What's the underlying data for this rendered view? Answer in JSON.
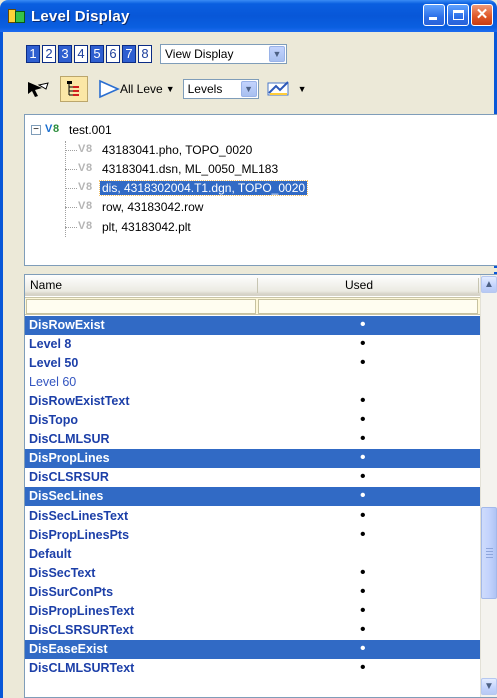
{
  "window": {
    "title": "Level Display"
  },
  "toolbar1": {
    "view_numbers": [
      "1",
      "2",
      "3",
      "4",
      "5",
      "6",
      "7",
      "8"
    ],
    "view_mode": "View Display"
  },
  "toolbar2": {
    "all_levels_label": "All Leve",
    "levels_select": "Levels"
  },
  "tree": {
    "root": "test.001",
    "children": [
      "43183041.pho, TOPO_0020",
      "43183041.dsn, ML_0050_ML183",
      "dis, 4318302004.T1.dgn, TOPO_0020",
      "row, 43183042.row",
      "plt, 43183042.plt"
    ],
    "selected_index": 2
  },
  "list": {
    "columns": [
      "Name",
      "Used"
    ],
    "rows": [
      {
        "name": "DisRowExist",
        "used": "•",
        "selected": true
      },
      {
        "name": "Level 8",
        "used": "•",
        "selected": false
      },
      {
        "name": "Level 50",
        "used": "•",
        "selected": false
      },
      {
        "name": "Level 60",
        "used": "",
        "selected": false
      },
      {
        "name": "DisRowExistText",
        "used": "•",
        "selected": false
      },
      {
        "name": "DisTopo",
        "used": "•",
        "selected": false
      },
      {
        "name": "DisCLMLSUR",
        "used": "•",
        "selected": false
      },
      {
        "name": "DisPropLines",
        "used": "•",
        "selected": true
      },
      {
        "name": "DisCLSRSUR",
        "used": "•",
        "selected": false
      },
      {
        "name": "DisSecLines",
        "used": "•",
        "selected": true
      },
      {
        "name": "DisSecLinesText",
        "used": "•",
        "selected": false
      },
      {
        "name": "DisPropLinesPts",
        "used": "•",
        "selected": false
      },
      {
        "name": "Default",
        "used": "",
        "selected": false
      },
      {
        "name": "DisSecText",
        "used": "•",
        "selected": false
      },
      {
        "name": "DisSurConPts",
        "used": "•",
        "selected": false
      },
      {
        "name": "DisPropLinesText",
        "used": "•",
        "selected": false
      },
      {
        "name": "DisCLSRSURText",
        "used": "•",
        "selected": false
      },
      {
        "name": "DisEaseExist",
        "used": "•",
        "selected": true
      },
      {
        "name": "DisCLMLSURText",
        "used": "•",
        "selected": false
      }
    ]
  },
  "colors": {
    "selection": "#316ac5",
    "level_text": "#1c3fa8",
    "titlebar": "#0857d8"
  }
}
